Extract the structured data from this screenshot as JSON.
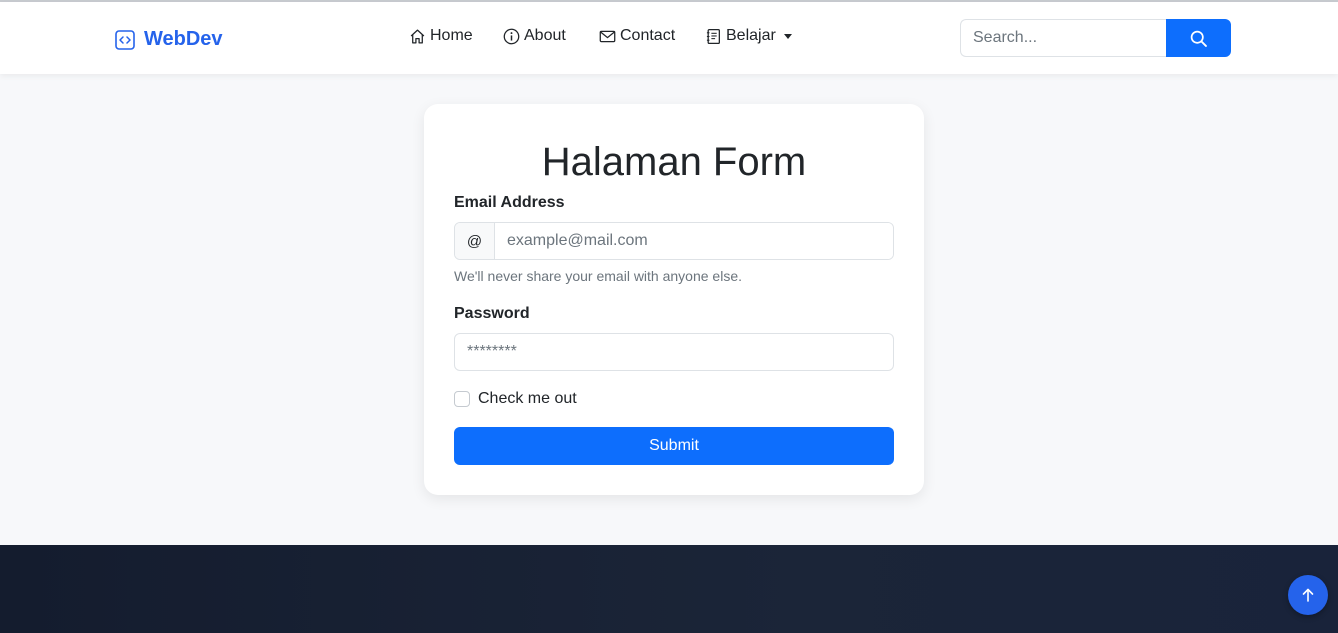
{
  "navbar": {
    "brand": "WebDev",
    "brand_icon": "code-square-icon",
    "brand_color": "#2563eb",
    "links": [
      {
        "label": "Home",
        "icon": "house-icon"
      },
      {
        "label": "About",
        "icon": "info-circle-icon"
      },
      {
        "label": "Contact",
        "icon": "envelope-icon"
      },
      {
        "label": "Belajar",
        "icon": "journal-text-icon",
        "dropdown": true
      }
    ],
    "search": {
      "placeholder": "Search...",
      "value": "",
      "button_icon": "search-icon",
      "button_color": "#0d6efd"
    }
  },
  "form": {
    "title": "Halaman Form",
    "email_label": "Email Address",
    "email_addon": "@",
    "email_placeholder": "example@mail.com",
    "email_value": "",
    "email_help": "We'll never share your email with anyone else.",
    "password_label": "Password",
    "password_placeholder": "********",
    "password_value": "",
    "checkbox_label": "Check me out",
    "checkbox_checked": false,
    "submit_label": "Submit",
    "accent": "#0d6efd"
  },
  "back_to_top": {
    "icon": "arrow-up-icon"
  }
}
